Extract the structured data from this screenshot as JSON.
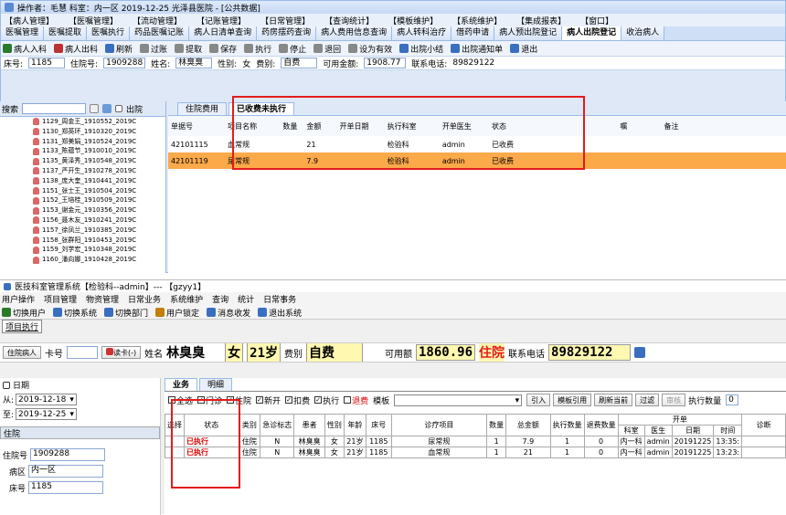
{
  "top": {
    "titlebar": "操作者：毛慧  科室：内一区  2019-12-25  光泽县医院 - [公共数据]",
    "menus": [
      "【病人管理】",
      "【医嘱管理】",
      "【流动管理】",
      "【记账管理】",
      "【日常管理】",
      "【查询统计】",
      "【模板维护】",
      "【系统维护】",
      "【集成报表】",
      "【窗口】"
    ],
    "tabs": [
      "医嘱管理",
      "医嘱提取",
      "医嘱执行",
      "药品医嘱记账",
      "病人日清单查询",
      "药房摆药查询",
      "病人费用信息查询",
      "病人转科治疗",
      "借药申请",
      "病人预出院登记",
      "病人出院登记",
      "收治病人"
    ],
    "active_tab": "病人出院登记",
    "toolbar": [
      "病人入科",
      "病人出科",
      "刷新",
      "过账",
      "提取",
      "保存",
      "执行",
      "停止",
      "退回",
      "设为有效",
      "出院小结",
      "出院通知单",
      "退出"
    ],
    "info": {
      "bed_label": "床号:",
      "bed": "1185",
      "inpatient_label": "住院号:",
      "inpatient": "1909288",
      "name_label": "姓名:",
      "name": "林臭臭",
      "sex_label": "性别:",
      "sex": "女",
      "fee_label": "费别:",
      "fee": "自费",
      "avail_label": "可用金额:",
      "avail": "1908.77",
      "phone_label": "联系电话:",
      "phone": "89829122"
    },
    "search_label": "搜索",
    "discharge_label": "出院",
    "patients": [
      "1129_周金王_1910552_2019C",
      "1130_郑英环_1910320_2019C",
      "1131_郑美娟_1910524_2019C",
      "1133_陈蕴节_1910010_2019C",
      "1135_黄泽秀_1910548_2019C",
      "1137_严开生_1910278_2019C",
      "1138_庞大奎_1910441_2019C",
      "1151_张士王_1910504_2019C",
      "1152_王培桂_1910509_2019C",
      "1153_谢金元_1910356_2019C",
      "1156_聂木友_1910241_2019C",
      "1157_徐凤兰_1910385_2019C",
      "1158_张群阳_1910453_2019C",
      "1159_刘学宏_1910348_2019C",
      "1160_潘向娜_1910428_2019C"
    ],
    "subtabs": [
      "住院费用",
      "已收费未执行"
    ],
    "grid": {
      "headers": [
        "单据号",
        "项目名称",
        "数量",
        "金额",
        "开单日期",
        "执行科室",
        "开单医生",
        "状态",
        "",
        "嘱",
        "备注"
      ],
      "rows": [
        [
          "42101115",
          "血常规",
          "",
          "21",
          "",
          "检验科",
          "admin",
          "已收费"
        ],
        [
          "42101119",
          "尿常规",
          "",
          "7.9",
          "",
          "检验科",
          "admin",
          "已收费"
        ]
      ]
    }
  },
  "bottom": {
    "title": "医技科室管理系统【检验科--admin】--- 【gzyy1】",
    "menus": [
      "用户操作",
      "项目管理",
      "物资管理",
      "日常业务",
      "系统维护",
      "查询",
      "统计",
      "日常事务"
    ],
    "toolbar": [
      "切换用户",
      "切换系统",
      "切换部门",
      "用户锁定",
      "消息收发",
      "退出系统"
    ],
    "tab": "项目执行",
    "info": {
      "type": "住院病人",
      "card_label": "卡号",
      "card_btn": "读卡(-)",
      "name_label": "姓名",
      "name": "林臭臭",
      "sex": "女",
      "age": "21岁",
      "fee_label": "费别",
      "fee": "自费",
      "avail_label": "可用额",
      "avail": "1860.96",
      "status": "住院",
      "phone_label": "联系电话",
      "phone": "89829122"
    },
    "left": {
      "date_label": "日期",
      "from_label": "从:",
      "from": "2019-12-18",
      "to_label": "至:",
      "to": "2019-12-25",
      "section": "住院",
      "inpatient_label": "住院号",
      "inpatient": "1909288",
      "ward_label": "病区",
      "ward": "内一区",
      "bed_label": "床号",
      "bed": "1185"
    },
    "subtabs": [
      "业务",
      "明细"
    ],
    "filters": [
      "全选",
      "门诊",
      "住院",
      "新开",
      "扣费",
      "执行",
      "退费"
    ],
    "template_label": "模板",
    "buttons": [
      "引入",
      "模板引用",
      "刷新当前",
      "过滤",
      "审核",
      "执行数量"
    ],
    "exec_qty": "0",
    "grid": {
      "headers": [
        "选择",
        "状态",
        "类别",
        "急诊标志",
        "患者",
        "性别",
        "年龄",
        "床号",
        "诊疗项目",
        "数量",
        "总金额",
        "执行数量",
        "退费数量",
        "开单",
        "诊断"
      ],
      "sub_headers": [
        "科室",
        "医生",
        "日期",
        "时间"
      ],
      "rows": [
        [
          "已执行",
          "住院",
          "N",
          "林臭臭",
          "女",
          "21岁",
          "1185",
          "尿常规",
          "1",
          "7.9",
          "1",
          "0",
          "内一科",
          "admin",
          "20191225",
          "13:35:"
        ],
        [
          "已执行",
          "住院",
          "N",
          "林臭臭",
          "女",
          "21岁",
          "1185",
          "血常规",
          "1",
          "21",
          "1",
          "0",
          "内一科",
          "admin",
          "20191225",
          "13:23:"
        ]
      ]
    }
  },
  "colors": {
    "accent": "#99bbe8",
    "highlight": "#fca94a",
    "alert": "#e31b1b"
  }
}
